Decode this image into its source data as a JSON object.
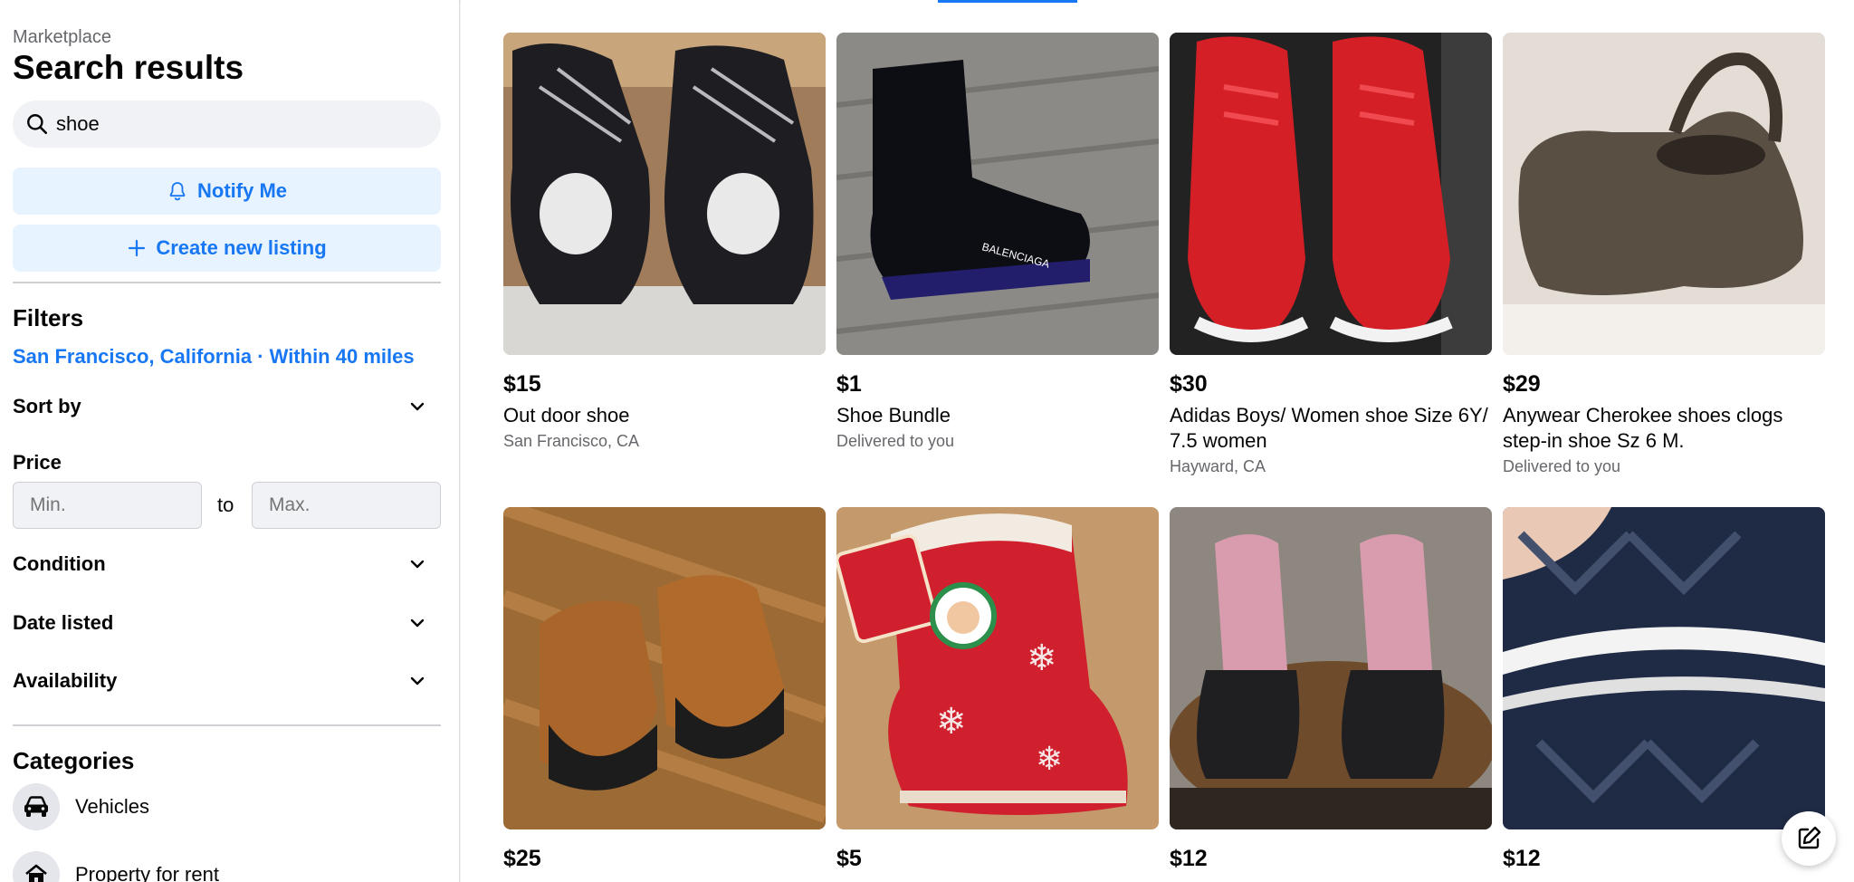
{
  "sidebar": {
    "breadcrumb": "Marketplace",
    "title": "Search results",
    "search": {
      "value": "shoe",
      "icon": "search-icon"
    },
    "notify_label": "Notify Me",
    "create_label": "Create new listing",
    "filters": {
      "heading": "Filters",
      "location": "San Francisco, California · Within 40 miles",
      "sort_by": "Sort by",
      "price_label": "Price",
      "min_placeholder": "Min.",
      "to_label": "to",
      "max_placeholder": "Max.",
      "condition": "Condition",
      "date_listed": "Date listed",
      "availability": "Availability"
    },
    "categories": {
      "heading": "Categories",
      "items": [
        {
          "label": "Vehicles",
          "icon": "car-icon"
        },
        {
          "label": "Property for rent",
          "icon": "house-icon"
        }
      ]
    }
  },
  "listings": [
    {
      "price": "$15",
      "title": "Out door shoe",
      "location": "San Francisco, CA"
    },
    {
      "price": "$1",
      "title": "Shoe Bundle",
      "location": "Delivered to you"
    },
    {
      "price": "$30",
      "title": "Adidas Boys/ Women shoe Size 6Y/ 7.5 women",
      "location": "Hayward, CA"
    },
    {
      "price": "$29",
      "title": "Anywear Cherokee shoes clogs step-in shoe Sz 6 M.",
      "location": "Delivered to you"
    },
    {
      "price": "$25",
      "title": "",
      "location": ""
    },
    {
      "price": "$5",
      "title": "",
      "location": ""
    },
    {
      "price": "$12",
      "title": "",
      "location": ""
    },
    {
      "price": "$12",
      "title": "",
      "location": ""
    }
  ],
  "colors": {
    "accent": "#1877f2",
    "accent_bg": "#e7f3ff",
    "muted_text": "#65676b"
  }
}
